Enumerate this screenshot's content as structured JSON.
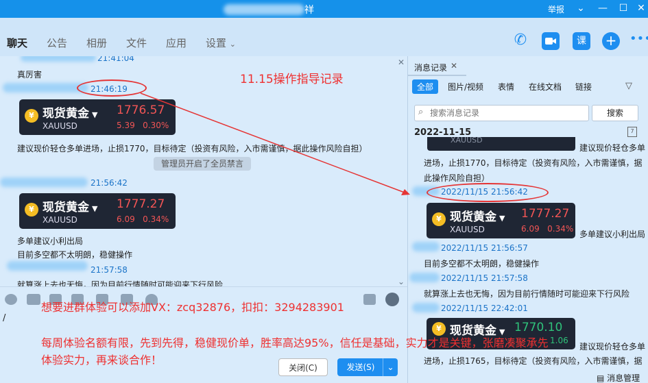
{
  "window": {
    "title": "祥",
    "report": "举报"
  },
  "tabs": [
    "聊天",
    "公告",
    "相册",
    "文件",
    "应用",
    "设置"
  ],
  "chat": {
    "messages": [
      {
        "time": "21:41:04",
        "text": "真厉害"
      },
      {
        "time": "21:46:19",
        "text": "建议现价轻仓多单进场，止损1770，目标待定（投资有风险，入市需谨慎，据此操作风险自担）"
      },
      {
        "system": "管理员开启了全员禁言"
      },
      {
        "time": "21:56:42",
        "text": "多单建议小利出局"
      },
      {
        "text": "目前多空都不太明朗，稳健操作"
      },
      {
        "time": "21:57:58",
        "text": "就算涨上去也无悔，因为目前行情随时可能迎来下行风险"
      }
    ],
    "card1": {
      "name": "现货黄金",
      "symbol": "XAUUSD",
      "price": "1776.57",
      "change": "5.39",
      "pct": "0.30%"
    },
    "card2": {
      "name": "现货黄金",
      "symbol": "XAUUSD",
      "price": "1777.27",
      "change": "6.09",
      "pct": "0.34%"
    }
  },
  "input": {
    "cursor": "/"
  },
  "buttons": {
    "close": "关闭(C)",
    "send": "发送(S)"
  },
  "history": {
    "title": "消息记录",
    "filters": [
      "全部",
      "图片/视频",
      "表情",
      "在线文档",
      "链接"
    ],
    "search_placeholder": "搜索消息记录",
    "search_btn": "搜索",
    "date": "2022-11-15",
    "cal_num": "7",
    "lines": [
      "XAUUSD",
      "建议现价轻仓多单",
      "进场，止损1770，目标待定（投资有风险，入市需谨慎，据",
      "此操作风险自担）",
      "2022/11/15 21:56:42",
      "多单建议小利出局",
      "2022/11/15 21:56:57",
      "目前多空都不太明朗，稳健操作",
      "2022/11/15 21:57:58",
      "就算涨上去也无悔，因为目前行情随时可能迎来下行风险",
      "2022/11/15 22:42:01",
      "建议现价轻仓多单",
      "进场，止损1765，目标待定（投资有风险，入市需谨慎，据"
    ],
    "card1": {
      "name": "现货黄金",
      "symbol": "XAUUSD",
      "price": "1777.27",
      "change": "6.09",
      "pct": "0.34%"
    },
    "card2": {
      "name": "现货黄金",
      "price": "1770.10",
      "change": "1.06"
    },
    "footer": "消息管理"
  },
  "overlay": {
    "title": "11.15操作指导记录",
    "line1": "想要进群体验可以添加VX：zcq32876，扣扣：3294283901",
    "line2": "每周体验名额有限，先到先得，稳健现价单，胜率高达95%，信任是基础，实力才是关键，张磨凑聚承先",
    "line3": "体验实力，再来谈合作！"
  },
  "colors": {
    "title_bar": "#1591ea",
    "accent": "#1e8ef0",
    "annotation": "#ee3030",
    "card_bg": "#1f2634"
  }
}
